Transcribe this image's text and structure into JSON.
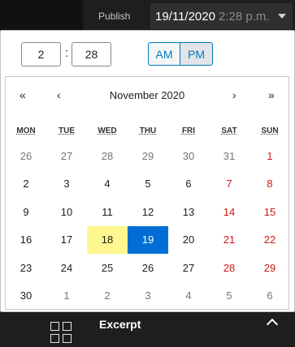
{
  "header": {
    "publish_label": "Publish",
    "date_value": "19/11/2020",
    "time_value": "2:28 p.m."
  },
  "time": {
    "hour": "2",
    "minute": "28",
    "separator": ":",
    "am_label": "AM",
    "pm_label": "PM",
    "selected_period": "PM"
  },
  "calendar": {
    "month_title": "November 2020",
    "prev_year": "«",
    "prev_month": "‹",
    "next_month": "›",
    "next_year": "»",
    "weekdays": [
      "MON",
      "TUE",
      "WED",
      "THU",
      "FRI",
      "SAT",
      "SUN"
    ],
    "days": [
      {
        "d": "26",
        "outside": true
      },
      {
        "d": "27",
        "outside": true
      },
      {
        "d": "28",
        "outside": true
      },
      {
        "d": "29",
        "outside": true
      },
      {
        "d": "30",
        "outside": true
      },
      {
        "d": "31",
        "outside": true
      },
      {
        "d": "1",
        "weekend": true
      },
      {
        "d": "2"
      },
      {
        "d": "3"
      },
      {
        "d": "4"
      },
      {
        "d": "5"
      },
      {
        "d": "6"
      },
      {
        "d": "7",
        "weekend": true
      },
      {
        "d": "8",
        "weekend": true
      },
      {
        "d": "9"
      },
      {
        "d": "10"
      },
      {
        "d": "11"
      },
      {
        "d": "12"
      },
      {
        "d": "13"
      },
      {
        "d": "14",
        "weekend": true
      },
      {
        "d": "15",
        "weekend": true
      },
      {
        "d": "16"
      },
      {
        "d": "17"
      },
      {
        "d": "18",
        "today": true
      },
      {
        "d": "19",
        "selected": true
      },
      {
        "d": "20"
      },
      {
        "d": "21",
        "weekend": true
      },
      {
        "d": "22",
        "weekend": true
      },
      {
        "d": "23"
      },
      {
        "d": "24"
      },
      {
        "d": "25"
      },
      {
        "d": "26"
      },
      {
        "d": "27"
      },
      {
        "d": "28",
        "weekend": true
      },
      {
        "d": "29",
        "weekend": true
      },
      {
        "d": "30"
      },
      {
        "d": "1",
        "outside": true
      },
      {
        "d": "2",
        "outside": true
      },
      {
        "d": "3",
        "outside": true
      },
      {
        "d": "4",
        "outside": true
      },
      {
        "d": "5",
        "outside": true
      },
      {
        "d": "6",
        "outside": true
      }
    ]
  },
  "footer": {
    "excerpt_label": "Excerpt"
  },
  "colors": {
    "accent": "#007cba",
    "selected_day": "#006ed4",
    "today_highlight": "#fff78f",
    "weekend": "#cc1818"
  }
}
